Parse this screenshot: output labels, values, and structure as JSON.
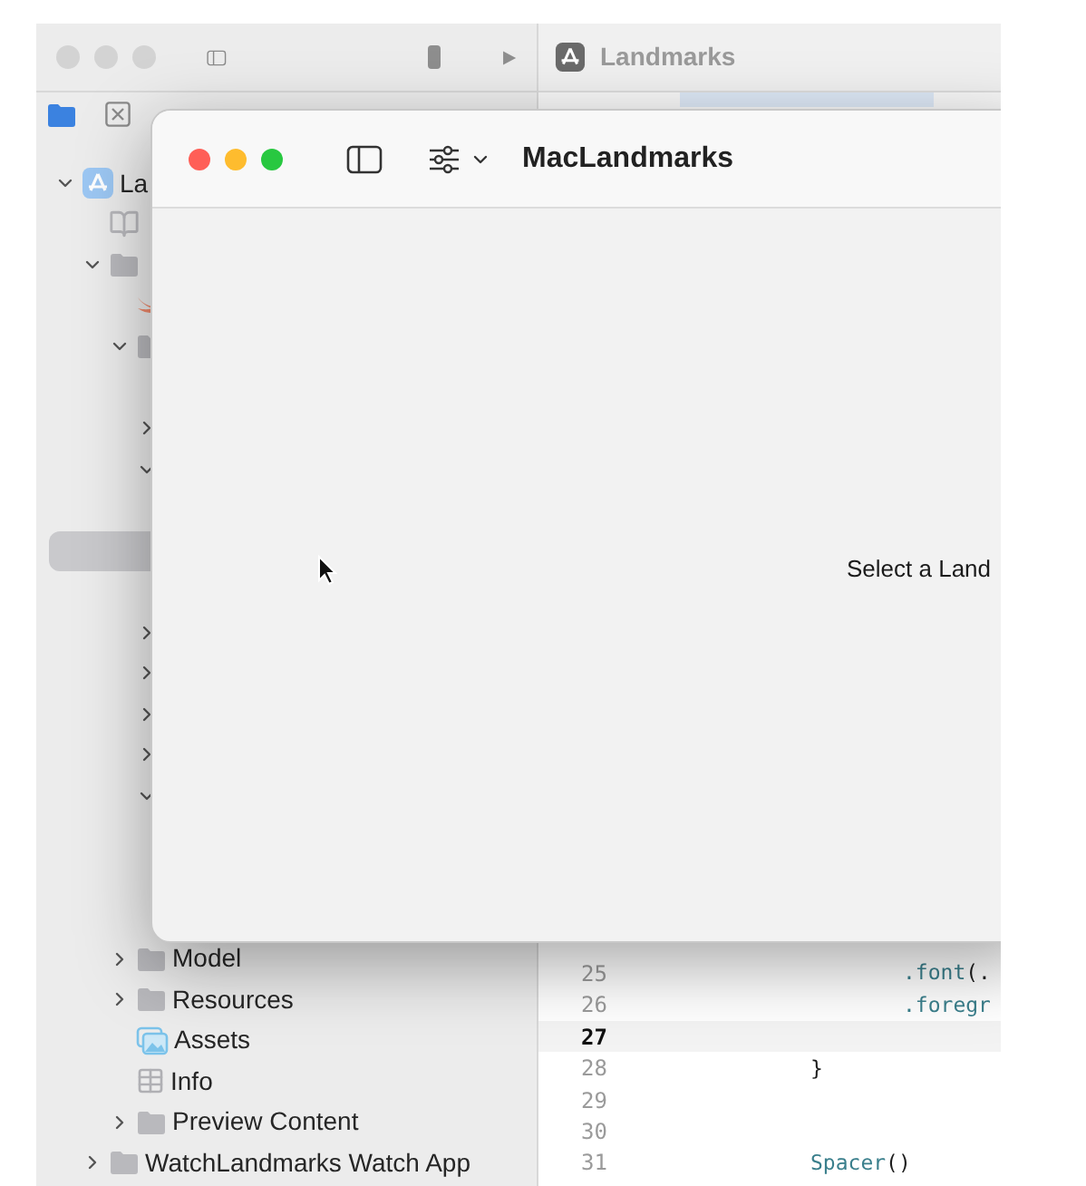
{
  "xcode": {
    "editor_title": "Landmarks"
  },
  "sidebar": {
    "tree": [
      {
        "label": "La",
        "kind": "project",
        "expanded": true,
        "selected": false,
        "children": [
          {
            "kind": "book",
            "selected": false
          },
          {
            "kind": "folder",
            "expanded": true,
            "selected": false,
            "children": [
              {
                "kind": "swift",
                "selected": false
              },
              {
                "kind": "folder",
                "expanded": true,
                "selected": false,
                "children": [
                  {
                    "selected": false
                  },
                  {
                    "expanded": false,
                    "selected": false
                  },
                  {
                    "expanded": true,
                    "selected": false,
                    "children": [
                      {
                        "selected": false
                      },
                      {
                        "selected": true
                      },
                      {
                        "selected": false
                      }
                    ]
                  },
                  {
                    "expanded": false,
                    "selected": false
                  },
                  {
                    "expanded": false,
                    "selected": false
                  },
                  {
                    "expanded": false,
                    "selected": false
                  },
                  {
                    "expanded": false,
                    "selected": false
                  },
                  {
                    "expanded": true,
                    "selected": false,
                    "children": [
                      {
                        "selected": false
                      },
                      {
                        "selected": false
                      },
                      {
                        "selected": false
                      }
                    ]
                  }
                ]
              },
              {
                "label": "Model",
                "kind": "folder",
                "expanded": false,
                "selected": false
              },
              {
                "label": "Resources",
                "kind": "folder",
                "expanded": false,
                "selected": false
              },
              {
                "label": "Assets",
                "kind": "assets",
                "selected": false
              },
              {
                "label": "Info",
                "kind": "plist",
                "selected": false
              },
              {
                "label": "Preview Content",
                "kind": "folder",
                "expanded": false,
                "selected": false
              }
            ]
          },
          {
            "label": "WatchLandmarks Watch App",
            "kind": "folder",
            "expanded": false,
            "selected": false
          }
        ]
      }
    ]
  },
  "code": {
    "lines": [
      {
        "number": "25",
        "current": false,
        "kind": "modifier",
        "tokens": [
          {
            "text": ".font",
            "kind": "method"
          },
          {
            "text": "(.",
            "kind": "plain"
          }
        ]
      },
      {
        "number": "26",
        "current": false,
        "kind": "modifier",
        "tokens": [
          {
            "text": ".foregr",
            "kind": "method"
          }
        ]
      },
      {
        "number": "27",
        "current": true
      },
      {
        "number": "28",
        "current": false,
        "kind": "statement",
        "tokens": [
          {
            "text": "}",
            "kind": "plain"
          }
        ]
      },
      {
        "number": "29",
        "current": false
      },
      {
        "number": "30",
        "current": false
      },
      {
        "number": "31",
        "current": false,
        "kind": "statement",
        "tokens": [
          {
            "text": "Spacer",
            "kind": "method"
          },
          {
            "text": "()",
            "kind": "plain"
          }
        ]
      }
    ]
  },
  "app_window": {
    "title": "MacLandmarks",
    "placeholder_message": "Select a Land"
  }
}
